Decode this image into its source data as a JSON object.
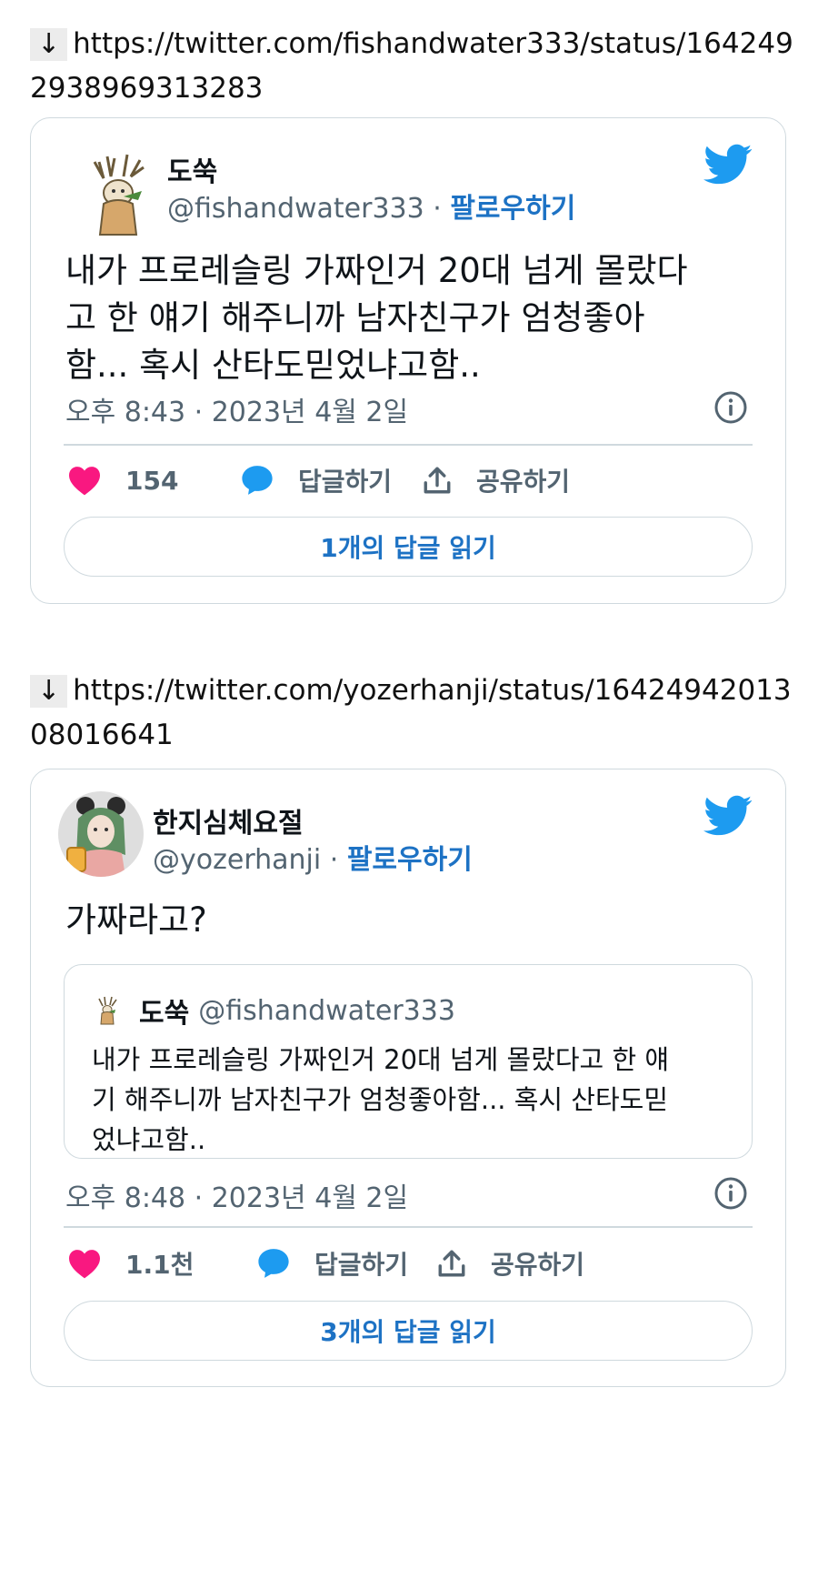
{
  "links": [
    {
      "arrow": "↓",
      "url": "https://twitter.com/fishandwater333/status/1642492938969313283"
    },
    {
      "arrow": "↓",
      "url": "https://twitter.com/yozerhanji/status/1642494201308016641"
    }
  ],
  "tweets": [
    {
      "display_name": "도쑥",
      "handle": "@fishandwater333",
      "separator": " · ",
      "follow_label": "팔로우하기",
      "text": "내가 프로레슬링 가짜인거 20대 넘게 몰랐다고 한 얘기 해주니까 남자친구가 엄청좋아함... 혹시 산타도믿었냐고함..",
      "timestamp": "오후 8:43 · 2023년 4월 2일",
      "likes": "154",
      "reply_label": "답글하기",
      "share_label": "공유하기",
      "read_replies_label": "1개의 답글 읽기"
    },
    {
      "display_name": "한지심체요절",
      "handle": "@yozerhanji",
      "separator": " · ",
      "follow_label": "팔로우하기",
      "text": "가짜라고?",
      "quoted": {
        "display_name": "도쑥",
        "handle": "@fishandwater333",
        "text": "내가 프로레슬링 가짜인거 20대 넘게 몰랐다고 한 얘기 해주니까 남자친구가 엄청좋아함... 혹시 산타도믿었냐고함.."
      },
      "timestamp": "오후 8:48 · 2023년 4월 2일",
      "likes": "1.1천",
      "reply_label": "답글하기",
      "share_label": "공유하기",
      "read_replies_label": "3개의 답글 읽기"
    }
  ],
  "icons": {
    "arrow": "down-arrow-icon",
    "twitter": "twitter-bird-icon",
    "like": "heart-icon",
    "reply": "speech-bubble-icon",
    "share": "share-upload-icon",
    "info": "info-circle-icon"
  },
  "colors": {
    "twitter_blue": "#1d9bf0",
    "link_blue": "#1d72c4",
    "heart_pink": "#f91880",
    "secondary_text": "#536471",
    "border": "#cfd9de"
  }
}
